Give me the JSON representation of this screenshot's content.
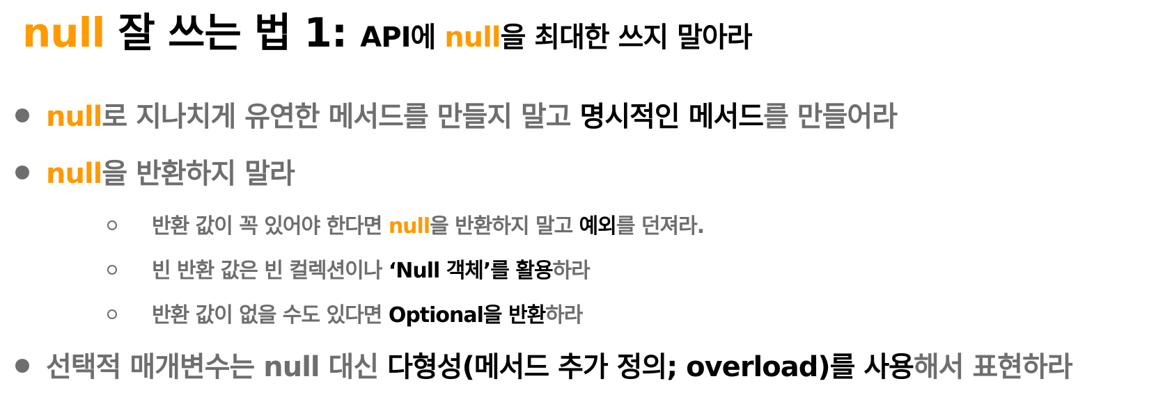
{
  "title": {
    "null_word": "null",
    "main": " 잘 쓰는 법 1: ",
    "sub_part1": "API에 ",
    "sub_null": "null",
    "sub_part2": "을 최대한 쓰지 말아라"
  },
  "bullets": [
    {
      "null_word": "null",
      "gray_text_1": "로 지나치게 유연한 메서드를 만들지 말고 ",
      "black_text_1": "명시적인 메서드",
      "gray_text_2": "를 만들어라"
    },
    {
      "null_word": "null",
      "gray_text_1": "을 반환하지 말라"
    },
    {
      "gray_text_1": "반환 값이 꼭 있어야 한다면 ",
      "null_word": "null",
      "gray_text_2": "을 반환하지 말고 ",
      "black_text_1": "예외",
      "gray_text_3": "를 던져라."
    },
    {
      "gray_text_1": "빈 반환 값은 빈 컬렉션이나 ",
      "black_text_1": "‘Null 객체’를 활용",
      "gray_text_2": "하라"
    },
    {
      "gray_text_1": "반환 값이 없을 수도 있다면 ",
      "black_text_1": "Optional을 반환",
      "gray_text_2": "하라"
    },
    {
      "gray_text_1": "선택적 매개변수는 null 대신 ",
      "black_text_1": "다형성(메서드 추가 정의; overload)를 사용",
      "gray_text_2": "해서 표현하라"
    }
  ],
  "colors": {
    "accent_orange": "#ff9a00",
    "text_gray": "#6e6e6e",
    "text_black": "#000000",
    "background": "#ffffff"
  }
}
